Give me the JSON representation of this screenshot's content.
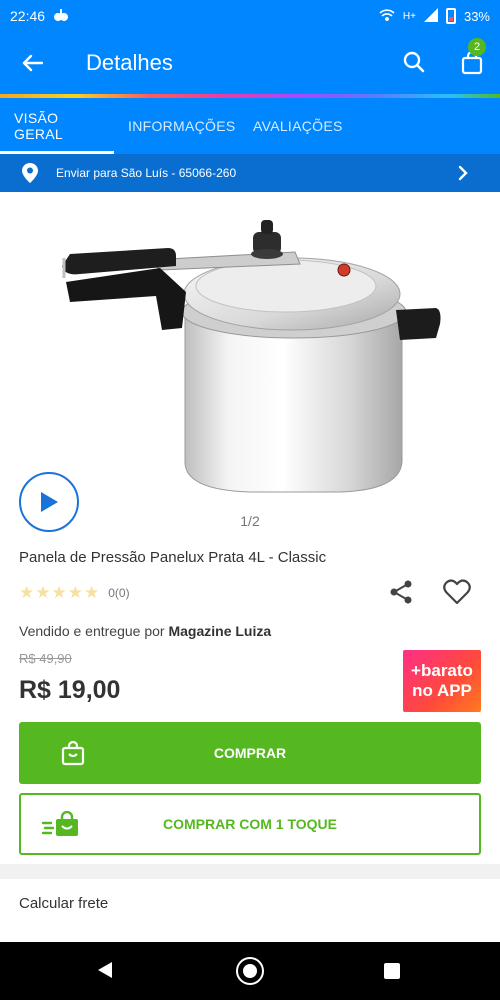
{
  "status_bar": {
    "time": "22:46",
    "network": "H+",
    "battery": "33%"
  },
  "app_bar": {
    "title": "Detalhes",
    "cart_count": "2"
  },
  "tabs": [
    {
      "label": "VISÃO GERAL",
      "active": true
    },
    {
      "label": "INFORMAÇÕES",
      "active": false
    },
    {
      "label": "AVALIAÇÕES",
      "active": false
    }
  ],
  "shipping": {
    "text": "Enviar para São Luís - 65066-260"
  },
  "product": {
    "pager": "1/2",
    "title": "Panela de Pressão Panelux Prata 4L - Classic",
    "rating_count": "0(0)",
    "seller_prefix": "Vendido e entregue por ",
    "seller_name": "Magazine Luiza",
    "old_price": "R$ 49,90",
    "price": "R$ 19,00"
  },
  "promo_badge": {
    "line1": "+barato",
    "line2": "no APP"
  },
  "actions": {
    "buy_label": "COMPRAR",
    "one_tap_label": "COMPRAR COM 1 TOQUE"
  },
  "freight": {
    "label": "Calcular frete"
  },
  "colors": {
    "primary_blue": "#0086ff",
    "buy_green": "#56b820"
  }
}
